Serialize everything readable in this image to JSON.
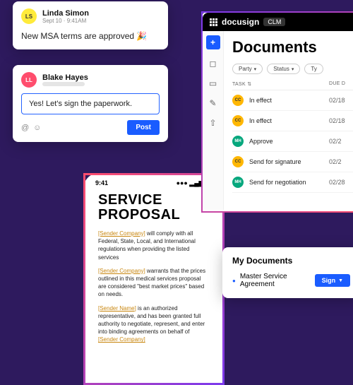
{
  "card1": {
    "avatar_initials": "LS",
    "user_name": "Linda Simon",
    "timestamp": "Sept 10 · 9:41AM",
    "message": "New MSA terms are approved 🎉"
  },
  "card2": {
    "avatar_initials": "LL",
    "user_name": "Blake Hayes",
    "reply_text": "Yes! Let's sign the paperwork.",
    "post_label": "Post"
  },
  "phone": {
    "time": "9:41",
    "title": "SERVICE PROPOSAL",
    "tag_company": "[Sender Company]",
    "tag_name": "[Sender Name]",
    "p1_rest": " will comply with all Federal, State, Local, and International regulations when providing the listed services",
    "p2_rest": " warrants that the prices outlined in this medical services proposal are considered \"best market prices\" based on needs.",
    "p3_rest": " is an authorized representative, and has been granted full authority to negotiate, represent, and enter into binding agreements on behalf of "
  },
  "app": {
    "brand": "docusign",
    "product_tag": "CLM",
    "title": "Documents",
    "filters": [
      "Party",
      "Status",
      "Ty"
    ],
    "th_task": "TASK",
    "th_sort": "⇅",
    "th_due": "DUE D",
    "rows": [
      {
        "initials": "CC",
        "dotcls": "d-cc",
        "task": "In effect",
        "due": "02/18"
      },
      {
        "initials": "CC",
        "dotcls": "d-cc",
        "task": "In effect",
        "due": "02/18"
      },
      {
        "initials": "MH",
        "dotcls": "d-mh",
        "task": "Approve",
        "due": "02/2"
      },
      {
        "initials": "CC",
        "dotcls": "d-cc",
        "task": "Send for signature",
        "due": "02/2"
      },
      {
        "initials": "MH",
        "dotcls": "d-mh",
        "task": "Send for negotiation",
        "due": "02/28"
      }
    ]
  },
  "card3": {
    "title": "My Documents",
    "doc_name": "Master Service Agreement",
    "sign_label": "Sign"
  }
}
